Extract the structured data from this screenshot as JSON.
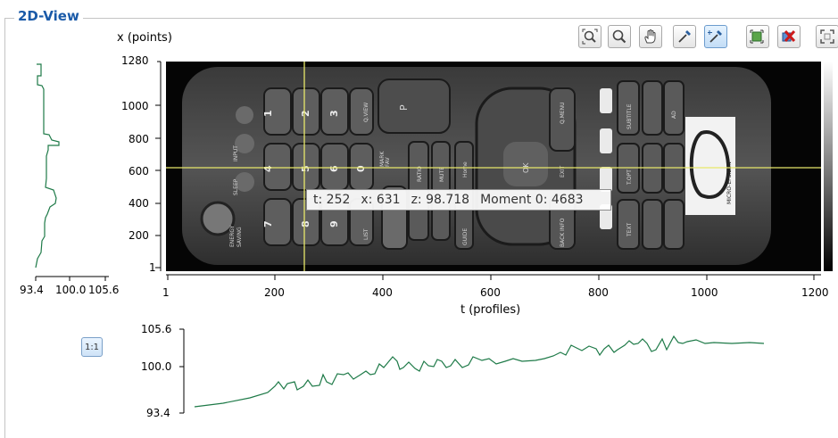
{
  "panel": {
    "title": "2D-View"
  },
  "toolbar": {
    "buttons": [
      {
        "icon": "zoom-fit-icon"
      },
      {
        "icon": "zoom-icon"
      },
      {
        "icon": "pan-hand-icon"
      },
      {
        "icon": "pipette-icon"
      },
      {
        "icon": "pipette-crosshair-icon",
        "active": true
      },
      {
        "icon": "add-region-icon"
      },
      {
        "icon": "delete-region-icon"
      },
      {
        "icon": "fit-all-icon"
      }
    ]
  },
  "image_view": {
    "y_axis_title": "x (points)",
    "y_ticks": [
      "1280",
      "1000",
      "800",
      "600",
      "400",
      "200",
      "1"
    ],
    "x_axis_title": "t (profiles)",
    "x_ticks": [
      "1",
      "200",
      "400",
      "600",
      "800",
      "1000",
      "1200"
    ]
  },
  "remote_labels": {
    "digits": [
      "1",
      "4",
      "7",
      "2",
      "5",
      "8",
      "3",
      "6",
      "9",
      "0"
    ],
    "text": [
      "INPUT",
      "SLEEP",
      "ENERGY",
      "SAVING",
      "Q.VIEW",
      "LIST",
      "FAV",
      "MARK",
      "RATIO",
      "MUTE",
      "Home",
      "GUIDE",
      "Q.MENU",
      "EXIT",
      "INFO",
      "BACK",
      "P",
      "OK",
      "SUBTITLE",
      "AD",
      "T.OPT",
      "TEXT",
      "MICRO-EPSILON"
    ]
  },
  "cursor": {
    "t_label": "t: 252",
    "x_label": "x: 631",
    "z_label": "z: 98.718",
    "moment_label": "Moment 0: 4683"
  },
  "left_profile": {
    "ticks": [
      "93.4",
      "100.0",
      "105.6"
    ]
  },
  "bottom_profile": {
    "ticks": [
      "105.6",
      "100.0",
      "93.4"
    ]
  },
  "ratio_button": {
    "label": "1:1"
  },
  "colors": {
    "title_blue": "#1a5aa8",
    "crosshair": "#e8e86a",
    "profile_green": "#1e7a48"
  }
}
